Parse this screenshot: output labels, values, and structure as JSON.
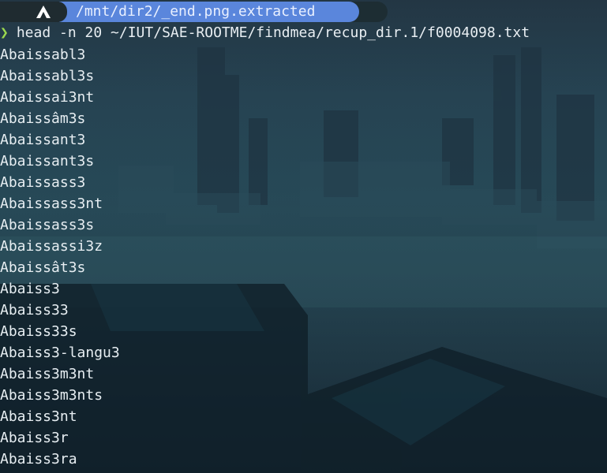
{
  "terminal": {
    "prompt_path": "/mnt/dir2/_end.png.extracted",
    "prompt_symbol": "❯",
    "command": "head -n 20 ~/IUT/SAE-ROOTME/findmea/recup_dir.1/f0004098.txt",
    "output_lines": [
      "Abaissabl3",
      "Abaissabl3s",
      "Abaissai3nt",
      "Abaissâm3s",
      "Abaissant3",
      "Abaissant3s",
      "Abaissass3",
      "Abaissass3nt",
      "Abaissass3s",
      "Abaissassi3z",
      "Abaissât3s",
      "Abaiss3",
      "Abaiss33",
      "Abaiss33s",
      "Abaiss3-langu3",
      "Abaiss3m3nt",
      "Abaiss3m3nts",
      "Abaiss3nt",
      "Abaiss3r",
      "Abaiss3ra"
    ]
  },
  "icons": {
    "os_logo": "arch-linux-icon"
  },
  "colors": {
    "path_background": "#5a86dc",
    "prompt_symbol": "#9bd84f",
    "text": "#e7eef2"
  }
}
